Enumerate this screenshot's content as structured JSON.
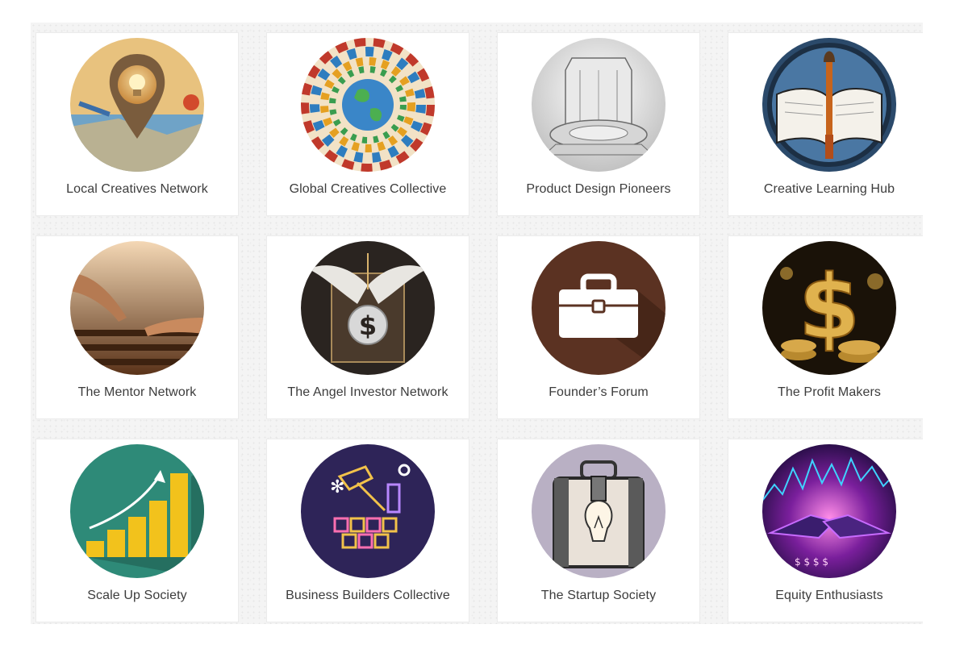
{
  "communities": [
    {
      "name": "Local Creatives Network",
      "icon": "map-pin-lightbulb-icon"
    },
    {
      "name": "Global Creatives Collective",
      "icon": "globe-people-circle-icon"
    },
    {
      "name": "Product Design Pioneers",
      "icon": "glass-prototype-icon"
    },
    {
      "name": "Creative Learning Hub",
      "icon": "book-paintbrush-icon"
    },
    {
      "name": "The Mentor Network",
      "icon": "reaching-hands-icon"
    },
    {
      "name": "The Angel Investor Network",
      "icon": "winged-dollar-icon"
    },
    {
      "name": "Founder’s Forum",
      "icon": "briefcase-icon"
    },
    {
      "name": "The Profit Makers",
      "icon": "gold-dollar-coins-icon"
    },
    {
      "name": "Scale Up Society",
      "icon": "growth-bar-chart-icon"
    },
    {
      "name": "Business Builders Collective",
      "icon": "neon-hammer-blocks-icon"
    },
    {
      "name": "The Startup Society",
      "icon": "lightbulb-suitcase-icon"
    },
    {
      "name": "Equity Enthusiasts",
      "icon": "neon-handshake-icon"
    }
  ],
  "colors": {
    "label_text": "#3c3c3c",
    "card_background": "#ffffff",
    "grid_background": "#f4f4f4"
  }
}
